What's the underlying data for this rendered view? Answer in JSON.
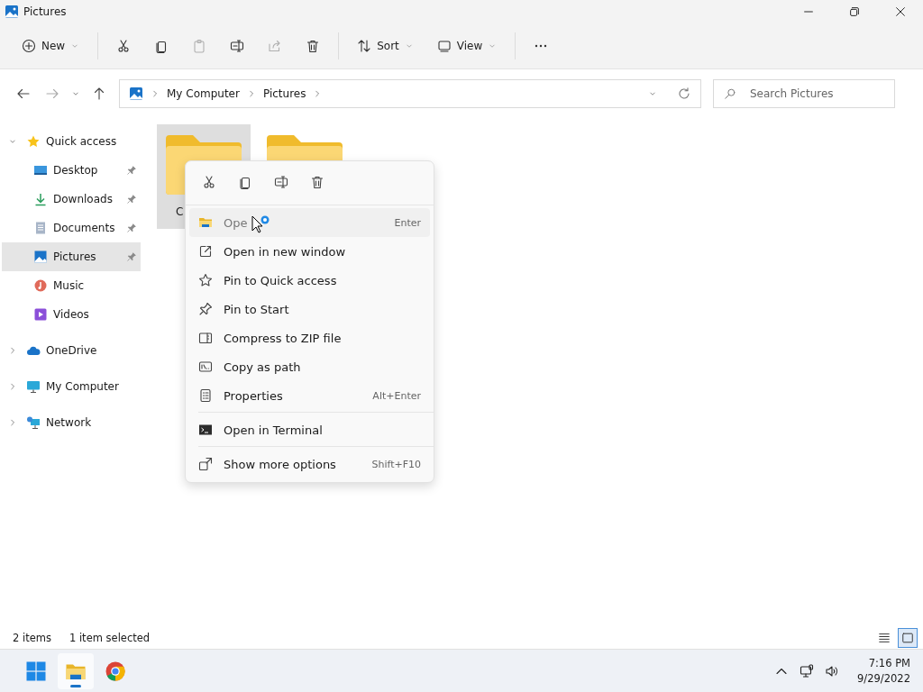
{
  "window": {
    "title": "Pictures"
  },
  "toolbar": {
    "groups": [
      [
        {
          "kind": "new",
          "label": "New",
          "dropdown": true,
          "disabled": false
        }
      ],
      [
        {
          "kind": "cut",
          "disabled": false
        },
        {
          "kind": "copy",
          "disabled": false
        },
        {
          "kind": "paste",
          "disabled": true
        },
        {
          "kind": "rename",
          "disabled": false
        },
        {
          "kind": "share",
          "disabled": true
        },
        {
          "kind": "delete",
          "disabled": false
        }
      ],
      [
        {
          "kind": "sort",
          "label": "Sort",
          "dropdown": true,
          "disabled": false
        },
        {
          "kind": "view",
          "label": "View",
          "dropdown": true,
          "disabled": false
        }
      ],
      [
        {
          "kind": "more",
          "disabled": false
        }
      ]
    ]
  },
  "navigation": {
    "back_disabled": false,
    "forward_disabled": true
  },
  "address_bar": {
    "crumbs": [
      "My Computer",
      "Pictures"
    ]
  },
  "search": {
    "placeholder": "Search Pictures"
  },
  "sidebar": {
    "items": [
      {
        "kind": "star",
        "label": "Quick access",
        "expanded": true,
        "selected": false,
        "children": [
          {
            "kind": "desktop",
            "label": "Desktop",
            "pinned": true,
            "selected": false
          },
          {
            "kind": "download",
            "label": "Downloads",
            "pinned": true,
            "selected": false
          },
          {
            "kind": "documents",
            "label": "Documents",
            "pinned": true,
            "selected": false
          },
          {
            "kind": "pictures",
            "label": "Pictures",
            "pinned": true,
            "selected": true
          },
          {
            "kind": "music",
            "label": "Music",
            "pinned": false,
            "selected": false
          },
          {
            "kind": "videos",
            "label": "Videos",
            "pinned": false,
            "selected": false
          }
        ]
      },
      {
        "kind": "cloud",
        "label": "OneDrive",
        "expanded": false,
        "selected": false
      },
      {
        "kind": "computer",
        "label": "My Computer",
        "expanded": false,
        "selected": false
      },
      {
        "kind": "network",
        "label": "Network",
        "expanded": false,
        "selected": false
      }
    ]
  },
  "folders": [
    {
      "name": "C",
      "selected": true
    },
    {
      "selected": false
    }
  ],
  "context_menu": {
    "quick_actions": [
      {
        "kind": "cut"
      },
      {
        "kind": "copy"
      },
      {
        "kind": "rename"
      },
      {
        "kind": "delete"
      }
    ],
    "sections": [
      [
        {
          "kind": "folder",
          "label": "Ope",
          "shortcut": "Enter",
          "highlighted": true
        },
        {
          "kind": "external",
          "label": "Open in new window",
          "highlighted": false
        },
        {
          "kind": "star-outline",
          "label": "Pin to Quick access",
          "highlighted": false
        },
        {
          "kind": "pin",
          "label": "Pin to Start",
          "highlighted": false
        },
        {
          "kind": "zip",
          "label": "Compress to ZIP file",
          "highlighted": false
        },
        {
          "kind": "path",
          "label": "Copy as path",
          "highlighted": false
        },
        {
          "kind": "properties",
          "label": "Properties",
          "shortcut": "Alt+Enter",
          "highlighted": false
        }
      ],
      [
        {
          "kind": "terminal",
          "label": "Open in Terminal",
          "highlighted": false
        }
      ],
      [
        {
          "kind": "more-options",
          "label": "Show more options",
          "shortcut": "Shift+F10",
          "highlighted": false
        }
      ]
    ]
  },
  "status_bar": {
    "item_count": "2 items",
    "selection": "1 item selected",
    "views": [
      {
        "kind": "details",
        "selected": false
      },
      {
        "kind": "tiles",
        "selected": true
      }
    ]
  },
  "taskbar": {
    "apps": [
      {
        "kind": "start",
        "active": false
      },
      {
        "kind": "explorer",
        "active": true
      },
      {
        "kind": "chrome",
        "active": false
      }
    ],
    "time": "7:16 PM",
    "date": "9/29/2022"
  }
}
